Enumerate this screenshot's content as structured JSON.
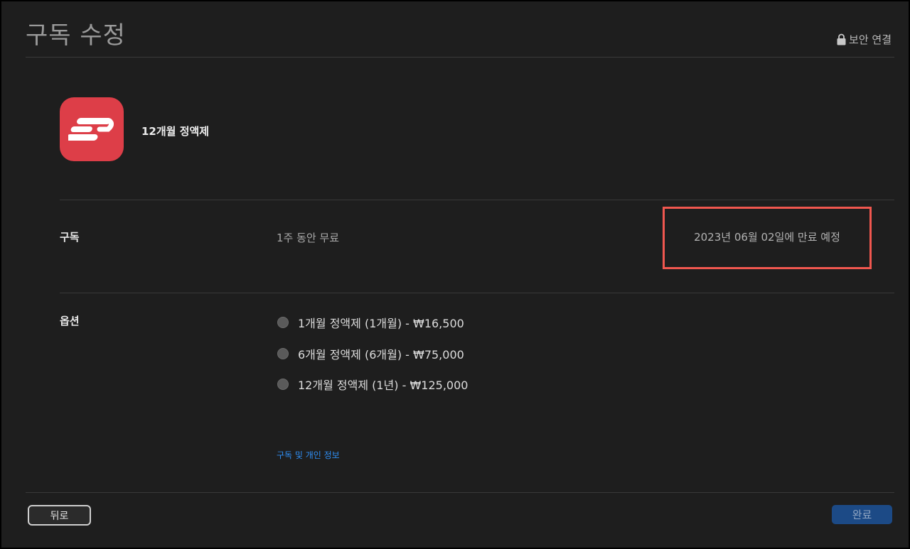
{
  "window": {
    "title": "구독 수정",
    "secure_label": "보안 연결"
  },
  "app": {
    "icon_name": "expressvpn-logo-icon",
    "brand_color": "#dd3e48",
    "plan_name": "12개월 정액제"
  },
  "subscription": {
    "label": "구독",
    "trial": "1주 동안 무료",
    "expiry": "2023년 06월 02일에 만료 예정",
    "highlight_color": "#f0574f"
  },
  "options": {
    "label": "옵션",
    "items": [
      {
        "label": "1개월 정액제 (1개월) - ₩16,500",
        "selected": false
      },
      {
        "label": "6개월 정액제 (6개월) - ₩75,000",
        "selected": false
      },
      {
        "label": "12개월 정액제 (1년) - ₩125,000",
        "selected": false
      }
    ]
  },
  "links": {
    "privacy": "구독 및 개인 정보"
  },
  "footer": {
    "back_label": "뒤로",
    "done_label": "완료"
  }
}
